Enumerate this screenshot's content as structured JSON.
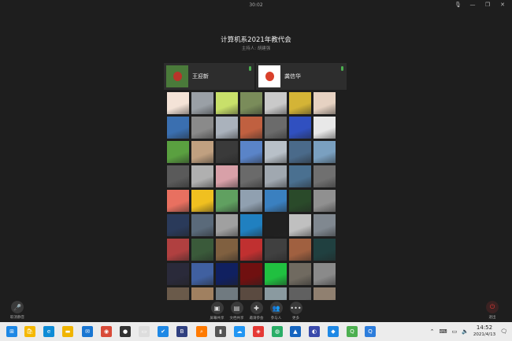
{
  "timer": "30:02",
  "window_controls": {
    "mic": "🎙",
    "minimize": "—",
    "restore": "❐",
    "close": "✕"
  },
  "meeting": {
    "title": "计算机系2021年教代会",
    "host_prefix": "主持人: ",
    "host_name": "胡建强"
  },
  "speakers": [
    {
      "name": "王迎新",
      "color": "#4a7a3a",
      "accent": "#b8342a"
    },
    {
      "name": "龚信华",
      "color": "#ffffff",
      "accent": "#d9402b"
    }
  ],
  "participants": [
    {
      "name": "",
      "c": "#f4e3d7"
    },
    {
      "name": "",
      "c": "#9aa0a6"
    },
    {
      "name": "",
      "c": "#c8e06a"
    },
    {
      "name": "",
      "c": "#7a8c5a"
    },
    {
      "name": "",
      "c": "#c9c9c9"
    },
    {
      "name": "",
      "c": "#d4b436"
    },
    {
      "name": "",
      "c": "#e6d2c2"
    },
    {
      "name": "",
      "c": "#3a6fb0"
    },
    {
      "name": "",
      "c": "#8a8a8a"
    },
    {
      "name": "",
      "c": "#aab2bc"
    },
    {
      "name": "",
      "c": "#c06040"
    },
    {
      "name": "",
      "c": "#6b6b6b"
    },
    {
      "name": "",
      "c": "#3050c0"
    },
    {
      "name": "",
      "c": "#e8e8e8"
    },
    {
      "name": "",
      "c": "#5aa040"
    },
    {
      "name": "",
      "c": "#c0a080"
    },
    {
      "name": "",
      "c": "#3a3a3a"
    },
    {
      "name": "",
      "c": "#5a84c8"
    },
    {
      "name": "",
      "c": "#b8c0c8"
    },
    {
      "name": "",
      "c": "#4a6a8a"
    },
    {
      "name": "",
      "c": "#7aa0c0"
    },
    {
      "name": "",
      "c": "#5a5a5a"
    },
    {
      "name": "",
      "c": "#b0b0b0"
    },
    {
      "name": "",
      "c": "#d8a0a8"
    },
    {
      "name": "",
      "c": "#6a6a6a"
    },
    {
      "name": "",
      "c": "#a0a8b0"
    },
    {
      "name": "",
      "c": "#4a7090"
    },
    {
      "name": "",
      "c": "#707070"
    },
    {
      "name": "",
      "c": "#e87060"
    },
    {
      "name": "",
      "c": "#f0c020"
    },
    {
      "name": "",
      "c": "#60a060"
    },
    {
      "name": "",
      "c": "#90a0b0"
    },
    {
      "name": "",
      "c": "#3a80c0"
    },
    {
      "name": "",
      "c": "#2a4a2a"
    },
    {
      "name": "",
      "c": "#909090"
    },
    {
      "name": "",
      "c": "#2a3a5a"
    },
    {
      "name": "",
      "c": "#5a6a7a"
    },
    {
      "name": "",
      "c": "#a0a0a0"
    },
    {
      "name": "",
      "c": "#2080c0"
    },
    {
      "name": "",
      "c": "#202020"
    },
    {
      "name": "",
      "c": "#c0c0c0"
    },
    {
      "name": "",
      "c": "#808890"
    },
    {
      "name": "",
      "c": "#b04040"
    },
    {
      "name": "",
      "c": "#3a5a3a"
    },
    {
      "name": "",
      "c": "#806040"
    },
    {
      "name": "",
      "c": "#c03030"
    },
    {
      "name": "",
      "c": "#404040"
    },
    {
      "name": "",
      "c": "#a06040"
    },
    {
      "name": "",
      "c": "#204040"
    },
    {
      "name": "",
      "c": "#2a2a3a"
    },
    {
      "name": "",
      "c": "#4060a0"
    },
    {
      "name": "",
      "c": "#102060"
    },
    {
      "name": "",
      "c": "#701010"
    },
    {
      "name": "",
      "c": "#20c040"
    },
    {
      "name": "",
      "c": "#706a60"
    },
    {
      "name": "",
      "c": "#8a8a8a"
    },
    {
      "name": "",
      "c": "#6a5a4a"
    },
    {
      "name": "",
      "c": "#a08060"
    },
    {
      "name": "",
      "c": "#707a80"
    },
    {
      "name": "",
      "c": "#5a4a40"
    },
    {
      "name": "",
      "c": "#8a9aa0"
    },
    {
      "name": "",
      "c": "#606060"
    },
    {
      "name": "",
      "c": "#908070"
    }
  ],
  "self_mic": {
    "label": "取消静音"
  },
  "toolbar": [
    {
      "icon": "▣",
      "label": "屏幕共享",
      "name": "share-screen"
    },
    {
      "icon": "▤",
      "label": "文档共享",
      "name": "share-document"
    },
    {
      "icon": "✚",
      "label": "邀请参会",
      "name": "invite"
    },
    {
      "icon": "👥",
      "label": "参与人",
      "name": "participants"
    },
    {
      "icon": "•••",
      "label": "更多",
      "name": "more"
    }
  ],
  "leave": {
    "label": "退出"
  },
  "taskbar": {
    "time": "14:52",
    "date": "2021/4/13",
    "icons": [
      {
        "name": "start",
        "glyph": "⊞",
        "color": "#1e88e5"
      },
      {
        "name": "store",
        "glyph": "🛍",
        "color": "#f5b800"
      },
      {
        "name": "edge",
        "glyph": "e",
        "color": "#0f8cd6"
      },
      {
        "name": "explorer",
        "glyph": "▬",
        "color": "#f0b400"
      },
      {
        "name": "mail",
        "glyph": "✉",
        "color": "#1976d2"
      },
      {
        "name": "chrome",
        "glyph": "◉",
        "color": "#d84a38"
      },
      {
        "name": "app-dark",
        "glyph": "●",
        "color": "#333"
      },
      {
        "name": "app-white",
        "glyph": "▭",
        "color": "#ddd"
      },
      {
        "name": "app-tick",
        "glyph": "✔",
        "color": "#1e88e5"
      },
      {
        "name": "app-bupt",
        "glyph": "B",
        "color": "#304080"
      },
      {
        "name": "search",
        "glyph": "⌕",
        "color": "#ff7a00"
      },
      {
        "name": "app-bar",
        "glyph": "▮",
        "color": "#555"
      },
      {
        "name": "app-cloud",
        "glyph": "☁",
        "color": "#2196f3"
      },
      {
        "name": "app-red",
        "glyph": "◈",
        "color": "#e53935"
      },
      {
        "name": "wechat",
        "glyph": "◍",
        "color": "#2aae67"
      },
      {
        "name": "app-blue",
        "glyph": "▲",
        "color": "#1565c0"
      },
      {
        "name": "app-chat",
        "glyph": "◐",
        "color": "#3949ab"
      },
      {
        "name": "app-doc",
        "glyph": "◆",
        "color": "#1e88e5"
      },
      {
        "name": "app-q",
        "glyph": "Q",
        "color": "#4caf50"
      },
      {
        "name": "app-meeting",
        "glyph": "Q",
        "color": "#2d7ddc"
      }
    ]
  }
}
